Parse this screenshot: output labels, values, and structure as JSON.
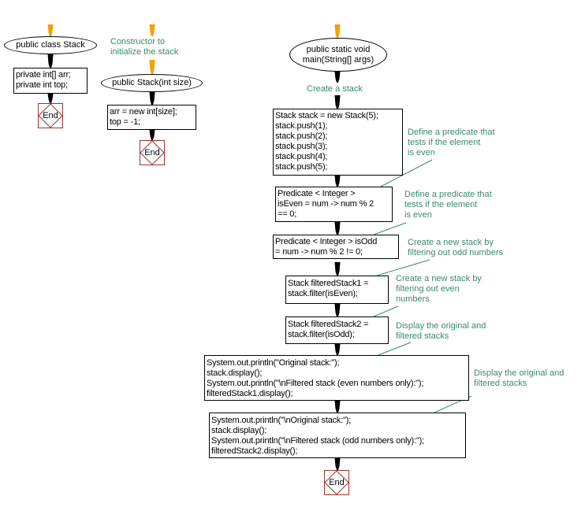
{
  "colors": {
    "start_arrow": "#f5a000",
    "flow_arrow": "#000000",
    "comment_text": "#3a8a6a",
    "comment_line": "#3a8a6a",
    "end_border": "#993333"
  },
  "class_flow": {
    "start_label": "public class Stack",
    "fields": "private int[] arr;\nprivate int top;",
    "end_label": "End"
  },
  "constructor_flow": {
    "comment": "Constructor to\ninitialize the stack",
    "start_label": "public Stack(int size)",
    "body": "arr = new int[size];\ntop = -1;",
    "end_label": "End"
  },
  "main_flow": {
    "start_label": "public static void\nmain(String[] args)",
    "create_comment": "Create a stack",
    "steps": [
      {
        "code": "Stack stack = new Stack(5);\nstack.push(1);\nstack.push(2);\nstack.push(3);\nstack.push(4);\nstack.push(5);"
      },
      {
        "code": "Predicate < Integer >\nisEven = num -> num % 2\n== 0;"
      },
      {
        "code": "Predicate < Integer > isOdd\n= num -> num % 2 != 0;"
      },
      {
        "code": "Stack filteredStack1 =\nstack.filter(isEven);"
      },
      {
        "code": "Stack filteredStack2 =\nstack.filter(isOdd);"
      },
      {
        "code": "System.out.println(\"Original stack:\");\nstack.display();\nSystem.out.println(\"\\nFiltered stack (even numbers only):\");\nfilteredStack1.display();"
      },
      {
        "code": "System.out.println(\"\\nOriginal stack:\");\nstack.display();\nSystem.out.println(\"\\nFiltered stack (odd numbers only):\");\nfilteredStack2.display();"
      }
    ],
    "comments": [
      "Define a predicate that\ntests if the element\nis even",
      "Define a predicate that\ntests if the element\nis even",
      "Create a new stack by\nfiltering out odd numbers",
      "Create a new stack by\nfiltering out even\nnumbers",
      "Display the original and\nfiltered stacks",
      "Display the original and\nfiltered stacks"
    ],
    "end_label": "End"
  }
}
